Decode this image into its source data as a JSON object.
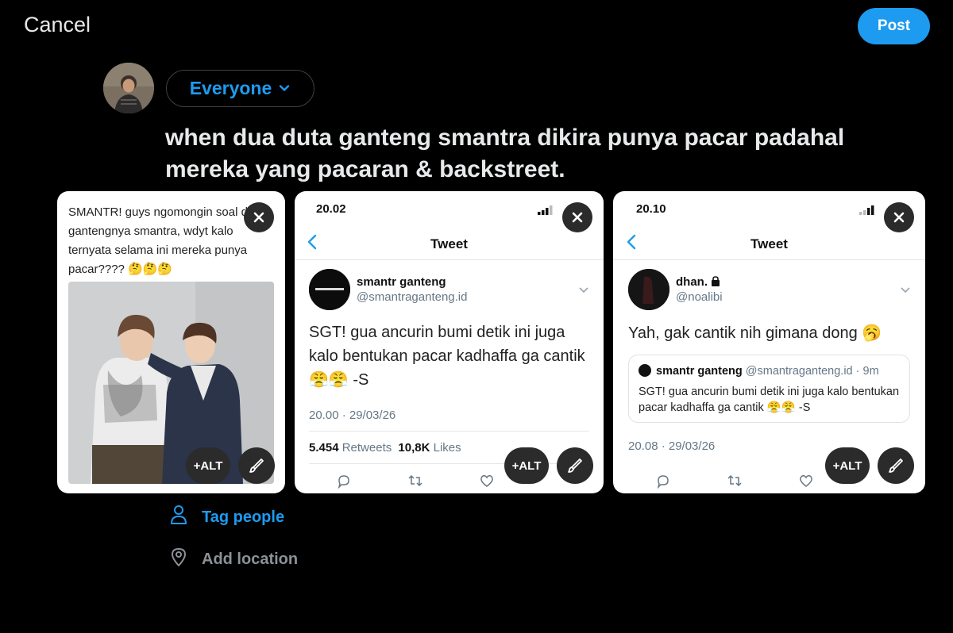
{
  "header": {
    "cancel_label": "Cancel",
    "post_label": "Post"
  },
  "composer": {
    "audience_label": "Everyone",
    "text": "when dua duta ganteng smantra dikira punya pacar padahal mereka yang pacaran & backstreet."
  },
  "attachments": {
    "alt_label": "+ALT",
    "card1": {
      "text": "SMANTR! guys ngomongin soal de gantengnya smantra, wdyt kalo ternyata selama ini mereka punya pacar???? 🤔🤔🤔"
    },
    "card2": {
      "status_time": "20.02",
      "nav_title": "Tweet",
      "name": "smantr ganteng",
      "handle": "@smantraganteng.id",
      "body": "SGT! gua ancurin bumi detik ini juga kalo bentukan pacar kadhaffa ga cantik 😤😤 -S",
      "meta": "20.00 · 29/03/26",
      "retweets_count": "5.454",
      "retweets_label": "Retweets",
      "likes_count": "10,8K",
      "likes_label": "Likes"
    },
    "card3": {
      "status_time": "20.10",
      "nav_title": "Tweet",
      "name": "dhan.",
      "handle": "@noalibi",
      "body": "Yah, gak cantik nih gimana dong 🥱",
      "quote_name": "smantr ganteng",
      "quote_handle": "@smantraganteng.id · 9m",
      "quote_body": "SGT! gua ancurin bumi detik ini juga kalo bentukan pacar kadhaffa ga cantik 😤😤 -S",
      "meta": "20.08 · 29/03/26"
    }
  },
  "options": {
    "tag_people": "Tag people",
    "add_location": "Add location"
  },
  "colors": {
    "accent": "#1d9bf0",
    "background": "#000000",
    "muted": "#8b9198"
  }
}
